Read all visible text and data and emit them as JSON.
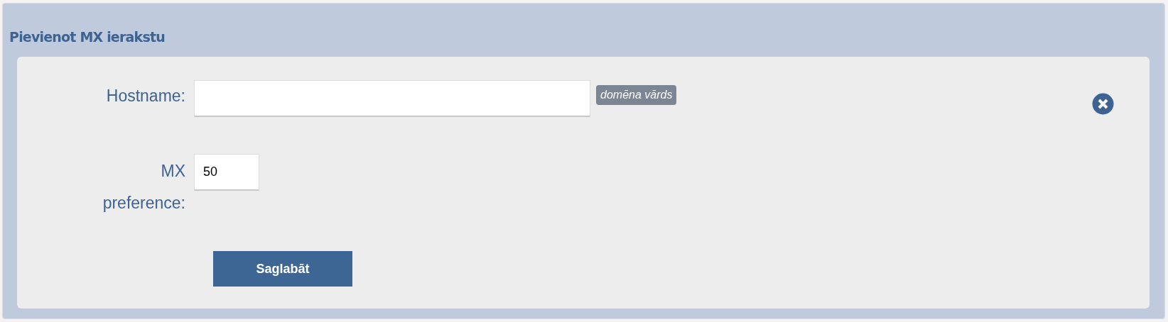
{
  "panel": {
    "title": "Pievienot MX ierakstu"
  },
  "fields": [
    {
      "label": "Hostname:",
      "hint": "domēna vārds",
      "kind": "wide"
    },
    {
      "label": "MX preference:",
      "value": "50",
      "kind": "narrow"
    }
  ],
  "buttons": [
    "Saglabāt"
  ]
}
